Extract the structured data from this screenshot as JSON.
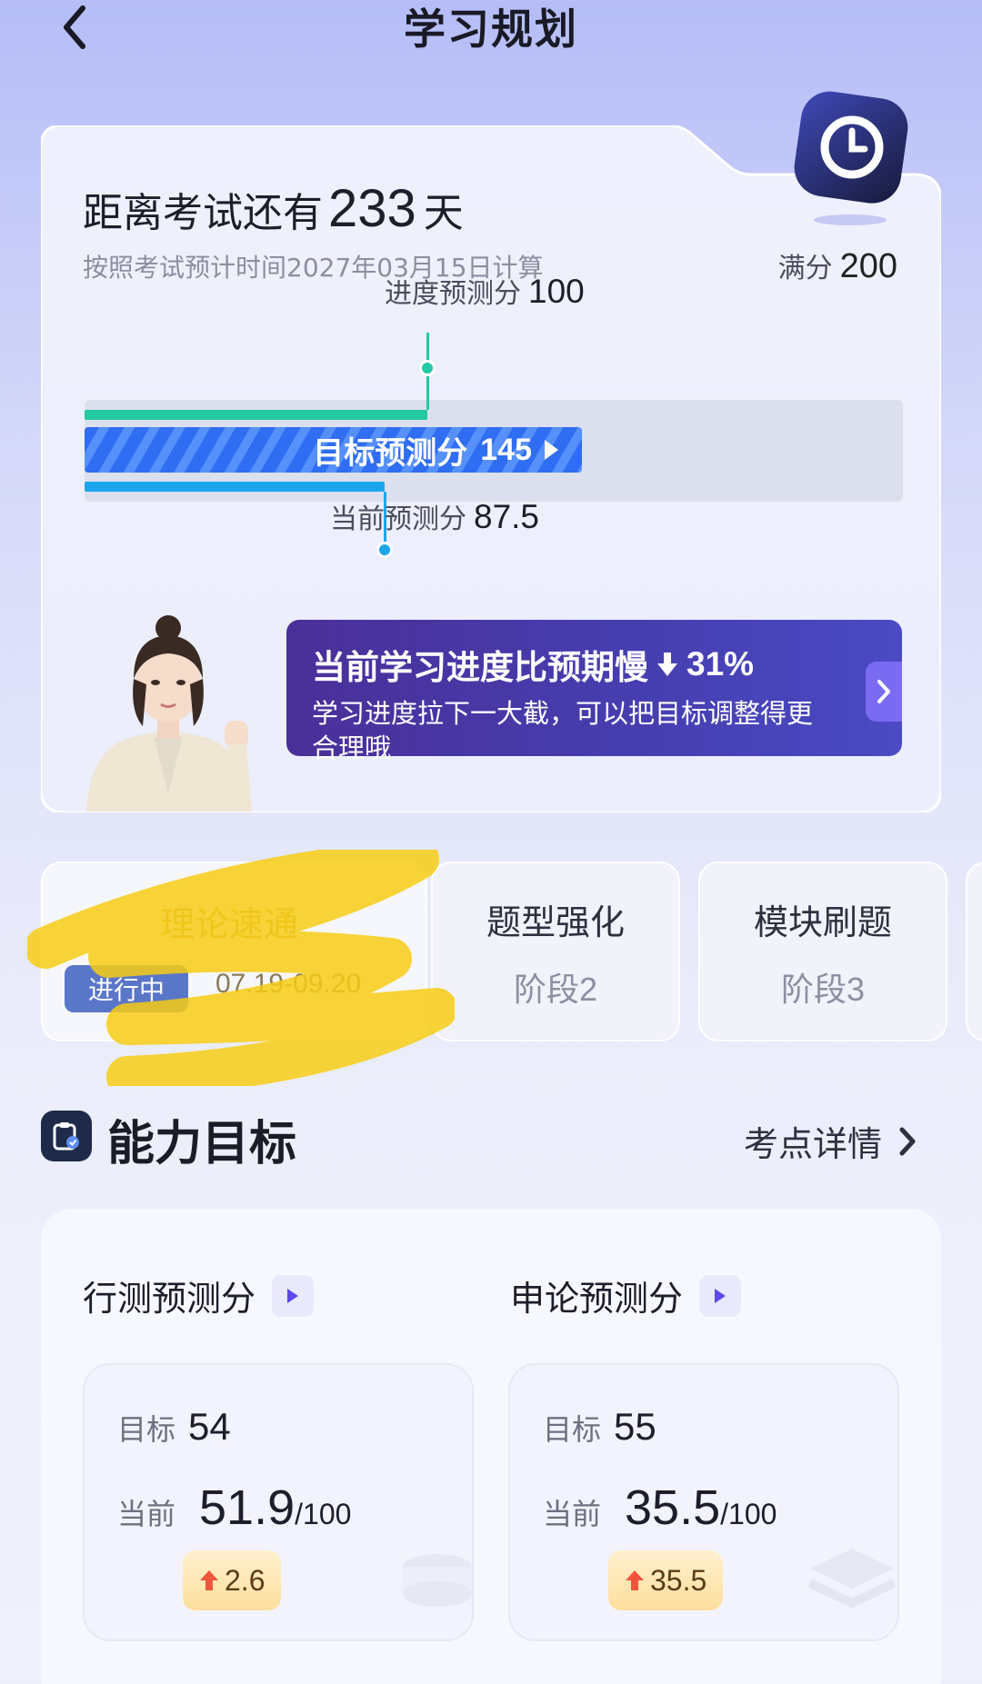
{
  "header": {
    "title": "学习规划",
    "back_icon": "chevron-left-icon"
  },
  "plan": {
    "countdown_prefix": "距离考试还有",
    "countdown_days": "233",
    "countdown_suffix": "天",
    "calc_note": "按照考试预计时间2027年03月15日计算",
    "full_score_label": "满分",
    "full_score_value": "200",
    "progress_label": "进度预测分",
    "progress_value": "100",
    "progress_fraction": 0.5,
    "target_label": "目标预测分",
    "target_value": "145",
    "target_fraction": 0.725,
    "current_label": "当前预测分",
    "current_value": "87.5",
    "current_fraction": 0.4375,
    "tip_title": "当前学习进度比预期慢",
    "tip_percent": "31%",
    "tip_body": "学习进度拉下一大截，可以把目标调整得更合理哦",
    "colors": {
      "progress": "#22c9a3",
      "target": "#2f6df2",
      "current": "#1ba6ec",
      "tip": "#4a2f98"
    }
  },
  "stages": [
    {
      "name": "理论速通",
      "status": "进行中",
      "dates": "07.19-09.20",
      "active": true
    },
    {
      "name": "题型强化",
      "sub": "阶段2"
    },
    {
      "name": "模块刷题",
      "sub": "阶段3"
    }
  ],
  "ability": {
    "title": "能力目标",
    "link": "考点详情",
    "left": {
      "title": "行测预测分",
      "target_label": "目标",
      "target": "54",
      "current_label": "当前",
      "current": "51.9",
      "denominator": "/100",
      "delta": "2.6"
    },
    "right": {
      "title": "申论预测分",
      "target_label": "目标",
      "target": "55",
      "current_label": "当前",
      "current": "35.5",
      "denominator": "/100",
      "delta": "35.5"
    }
  }
}
